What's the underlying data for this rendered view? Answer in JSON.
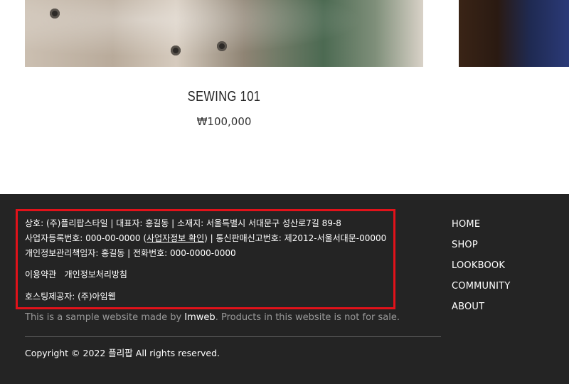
{
  "product": {
    "title": "SEWING 101",
    "price": "₩100,000"
  },
  "footer": {
    "line1": "상호: (주)플리팝스타일 | 대표자: 홍길동 | 소재지: 서울특별시 서대문구 성산로7길 89-8",
    "line2_prefix": "사업자등록번호: 000-00-0000 (",
    "line2_link": "사업자정보 확인",
    "line2_suffix": ") | 통신판매신고번호: 제2012-서울서대문-00000",
    "line3": "개인정보관리책임자: 홍길동 | 전화번호: 000-0000-0000",
    "terms_link": "이용약관",
    "privacy_link": "개인정보처리방침",
    "hosting": "호스팅제공자: (주)아임웹",
    "sample_prefix": "This is a sample website made by ",
    "sample_brand": "Imweb",
    "sample_suffix": ". Products in this website is not for sale.",
    "copyright": "Copyright © 2022 플리팝 All rights reserved.",
    "nav": [
      "HOME",
      "SHOP",
      "LOOKBOOK",
      "COMMUNITY",
      "ABOUT"
    ]
  },
  "colors": {
    "footer_bg": "#242424",
    "highlight_border": "#e2121a"
  }
}
